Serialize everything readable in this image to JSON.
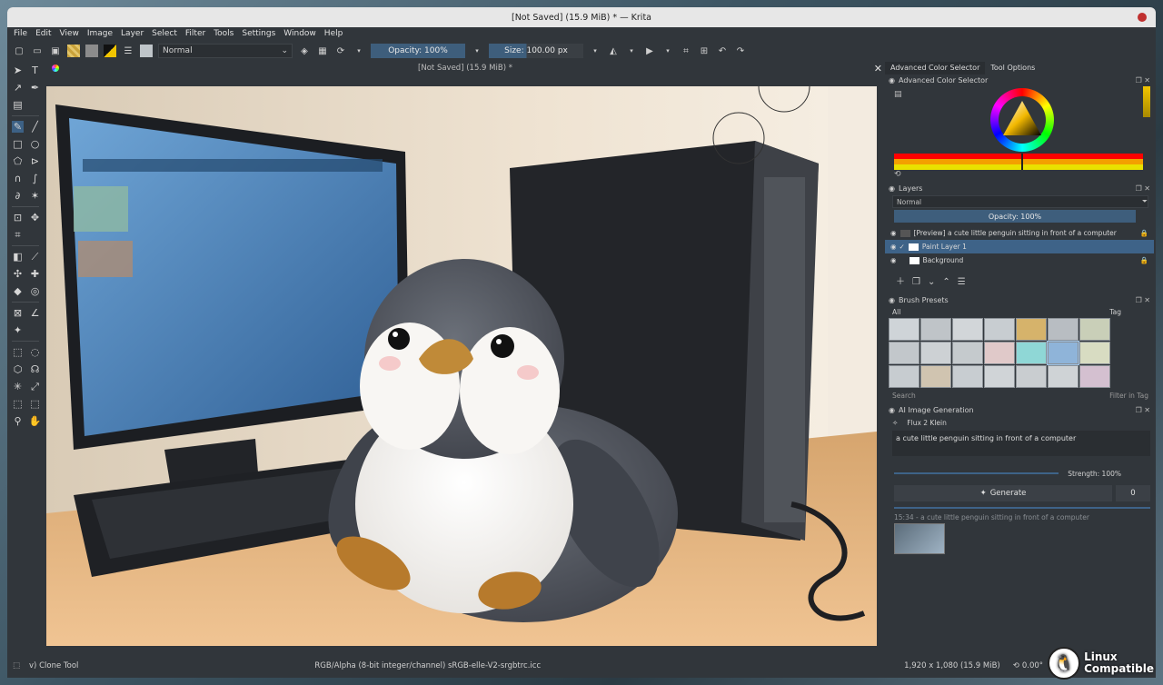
{
  "window": {
    "title": "[Not Saved]  (15.9 MiB) * — Krita"
  },
  "menu": [
    "File",
    "Edit",
    "View",
    "Image",
    "Layer",
    "Select",
    "Filter",
    "Tools",
    "Settings",
    "Window",
    "Help"
  ],
  "toolbar": {
    "blend_mode": "Normal",
    "opacity_label": "Opacity: 100%",
    "size_label": "Size: 100.00 px"
  },
  "canvas": {
    "doc_title": "[Not Saved]  (15.9 MiB) *"
  },
  "status": {
    "tool": "v) Clone Tool",
    "color_space": "RGB/Alpha (8-bit integer/channel)  sRGB-elle-V2-srgbtrc.icc",
    "dimensions": "1,920 x 1,080 (15.9 MiB)",
    "rotation": "0.00°"
  },
  "docker": {
    "tabs": [
      "Advanced Color Selector",
      "Tool Options"
    ],
    "color_selector_title": "Advanced Color Selector",
    "layers": {
      "title": "Layers",
      "blend_mode": "Normal",
      "opacity": "Opacity: 100%",
      "items": [
        {
          "name": "[Preview] a cute little penguin sitting in front of a computer",
          "selected": false
        },
        {
          "name": "Paint Layer 1",
          "selected": true
        },
        {
          "name": "Background",
          "selected": false
        }
      ]
    },
    "brush_presets": {
      "title": "Brush Presets",
      "filter": "All",
      "tag_label": "Tag",
      "search_placeholder": "Search",
      "filter_in_tag": "Filter in Tag"
    },
    "ai": {
      "title": "AI Image Generation",
      "model": "Flux 2 Klein",
      "prompt": "a cute little penguin sitting in front of a computer",
      "strength": "Strength: 100%",
      "generate_label": "Generate",
      "seed_count": "0",
      "history_item": "15:34 - a cute little penguin sitting in front of a computer"
    }
  },
  "watermark": {
    "line1": "Linux",
    "line2": "Compatible"
  },
  "colors": {
    "accent": "#3e6388",
    "window_bg": "#31363b",
    "titlebar": "#e7e7e7"
  }
}
